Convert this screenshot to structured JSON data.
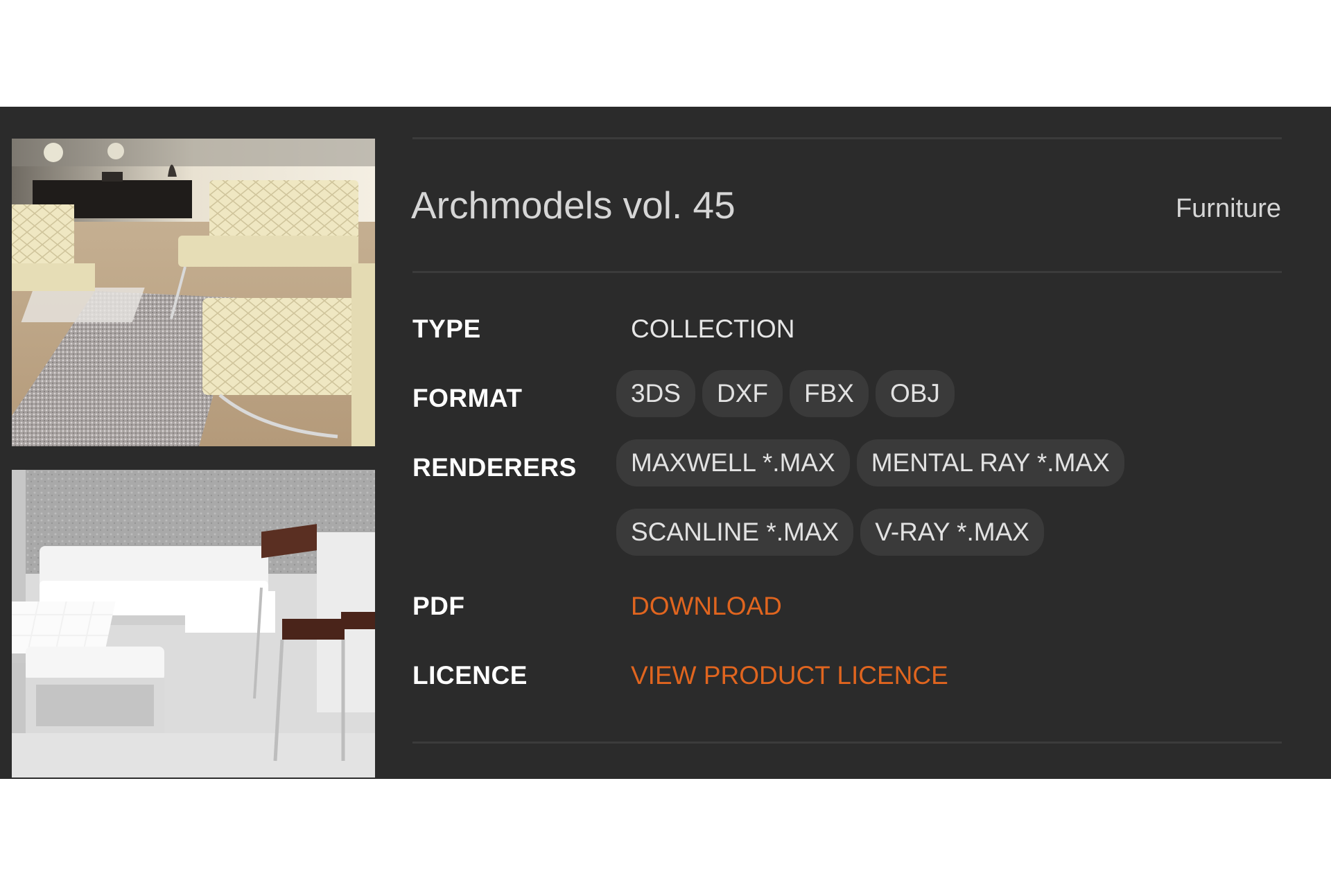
{
  "product": {
    "title": "Archmodels vol. 45",
    "category": "Furniture"
  },
  "details": {
    "type_label": "TYPE",
    "type_value": "COLLECTION",
    "format_label": "FORMAT",
    "formats": [
      "3DS",
      "DXF",
      "FBX",
      "OBJ"
    ],
    "renderers_label": "RENDERERS",
    "renderers": [
      "MAXWELL *.MAX",
      "MENTAL RAY *.MAX",
      "SCANLINE *.MAX",
      "V-RAY *.MAX"
    ],
    "pdf_label": "PDF",
    "pdf_link": "DOWNLOAD",
    "licence_label": "LICENCE",
    "licence_link": "VIEW PRODUCT LICENCE"
  },
  "colors": {
    "panel_bg": "#2b2b2b",
    "chip_bg": "#3a3a3a",
    "link": "#e0651f"
  }
}
